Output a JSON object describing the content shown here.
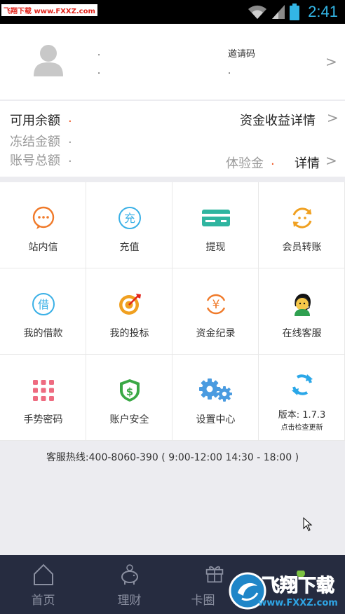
{
  "status_bar": {
    "watermark": "飞翔下载 www.FXXZ.com",
    "time": "2:41"
  },
  "profile": {
    "name_dot": ".",
    "sub_dot": ".",
    "invite_label": "邀请码",
    "invite_dot": ".",
    "chevron": ">"
  },
  "balance": {
    "available_label": "可用余额",
    "available_value": ".",
    "frozen_label": "冻结金额",
    "frozen_value": ".",
    "total_label": "账号总额",
    "total_value": ".",
    "fund_income_link": "资金收益详情",
    "trial_label": "体验金",
    "trial_value": ".",
    "detail_link": "详情",
    "chevron": ">"
  },
  "grid": {
    "items": [
      {
        "label": "站内信",
        "icon": "message-icon"
      },
      {
        "label": "充值",
        "icon": "recharge-icon"
      },
      {
        "label": "提现",
        "icon": "card-icon"
      },
      {
        "label": "会员转账",
        "icon": "transfer-icon"
      },
      {
        "label": "我的借款",
        "icon": "loan-icon"
      },
      {
        "label": "我的投标",
        "icon": "target-icon"
      },
      {
        "label": "资金纪录",
        "icon": "yen-icon"
      },
      {
        "label": "在线客服",
        "icon": "customer-service-icon"
      },
      {
        "label": "手势密码",
        "icon": "gesture-dots-icon"
      },
      {
        "label": "账户安全",
        "icon": "shield-dollar-icon"
      },
      {
        "label": "设置中心",
        "icon": "gears-icon"
      },
      {
        "label": "版本: 1.7.3",
        "sub": "点击检查更新",
        "icon": "update-icon"
      }
    ],
    "icon_text": {
      "recharge": "充",
      "loan": "借",
      "yen": "¥"
    }
  },
  "hotline": "客服热线:400-8060-390 ( 9:00-12:00  14:30 - 18:00 )",
  "tabs": [
    {
      "label": "首页",
      "icon": "home-icon"
    },
    {
      "label": "理财",
      "icon": "piggy-bank-icon"
    },
    {
      "label": "卡圈",
      "icon": "gift-icon"
    }
  ],
  "colors": {
    "accent_orange": "#f05a28",
    "icon_orange": "#f07a2a",
    "icon_blue": "#3ab0e6",
    "icon_teal": "#2fb5a0",
    "tabbar_bg": "#262c40",
    "status_time": "#33b5e5"
  }
}
